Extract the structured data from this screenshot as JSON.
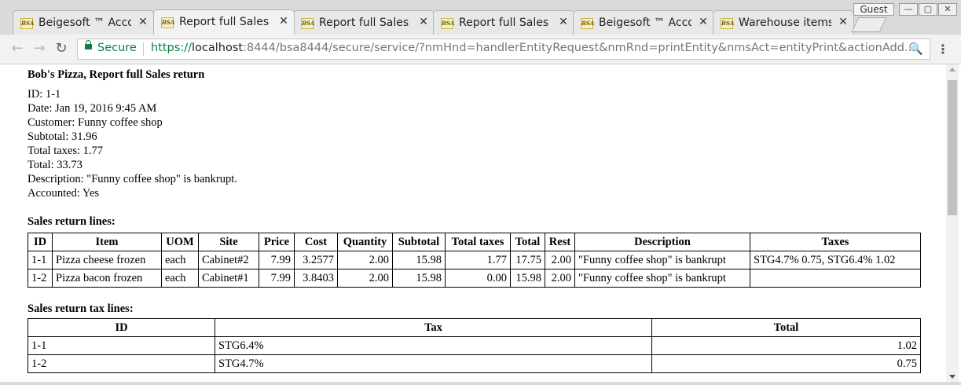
{
  "window": {
    "profile_label": "Guest",
    "minimize_glyph": "—",
    "maximize_glyph": "▢",
    "close_glyph": "✕"
  },
  "tabs": [
    {
      "favicon": "BSA",
      "title": "Beigesoft ™ Accounting",
      "close": "✕"
    },
    {
      "favicon": "BSA",
      "title": "Report full Sales return",
      "close": "✕"
    },
    {
      "favicon": "BSA",
      "title": "Report full Sales invoice",
      "close": "✕"
    },
    {
      "favicon": "BSA",
      "title": "Report full Sales invoice",
      "close": "✕"
    },
    {
      "favicon": "BSA",
      "title": "Beigesoft ™ Accounting",
      "close": "✕"
    },
    {
      "favicon": "BSA",
      "title": "Warehouse items",
      "close": "✕"
    }
  ],
  "toolbar": {
    "back_glyph": "←",
    "forward_glyph": "→",
    "reload_glyph": "↻",
    "secure_label": "Secure",
    "url_scheme": "https://",
    "url_host": "localhost",
    "url_rest": ":8444/bsa8444/secure/service/?nmHnd=handlerEntityRequest&nmRnd=printEntity&nmsAct=entityPrint&actionAdd...",
    "zoom_glyph": "🔍",
    "menu_glyph": "⋮"
  },
  "report": {
    "title": "Bob's Pizza, Report full Sales return",
    "fields": [
      "ID: 1-1",
      "Date: Jan 19, 2016 9:45 AM",
      "Customer: Funny coffee shop",
      "Subtotal: 31.96",
      "Total taxes: 1.77",
      "Total: 33.73",
      "Description: \"Funny coffee shop\" is bankrupt.",
      "Accounted: Yes"
    ],
    "lines_heading": "Sales return lines:",
    "lines_columns": [
      "ID",
      "Item",
      "UOM",
      "Site",
      "Price",
      "Cost",
      "Quantity",
      "Subtotal",
      "Total taxes",
      "Total",
      "Rest",
      "Description",
      "Taxes"
    ],
    "lines_rows": [
      [
        "1-1",
        "Pizza cheese frozen",
        "each",
        "Cabinet#2",
        "7.99",
        "3.2577",
        "2.00",
        "15.98",
        "1.77",
        "17.75",
        "2.00",
        "\"Funny coffee shop\" is bankrupt",
        "STG4.7% 0.75, STG6.4% 1.02"
      ],
      [
        "1-2",
        "Pizza bacon frozen",
        "each",
        "Cabinet#1",
        "7.99",
        "3.8403",
        "2.00",
        "15.98",
        "0.00",
        "15.98",
        "2.00",
        "\"Funny coffee shop\" is bankrupt",
        ""
      ]
    ],
    "tax_heading": "Sales return tax lines:",
    "tax_columns": [
      "ID",
      "Tax",
      "Total"
    ],
    "tax_rows": [
      [
        "1-1",
        "STG6.4%",
        "1.02"
      ],
      [
        "1-2",
        "STG4.7%",
        "0.75"
      ]
    ]
  }
}
